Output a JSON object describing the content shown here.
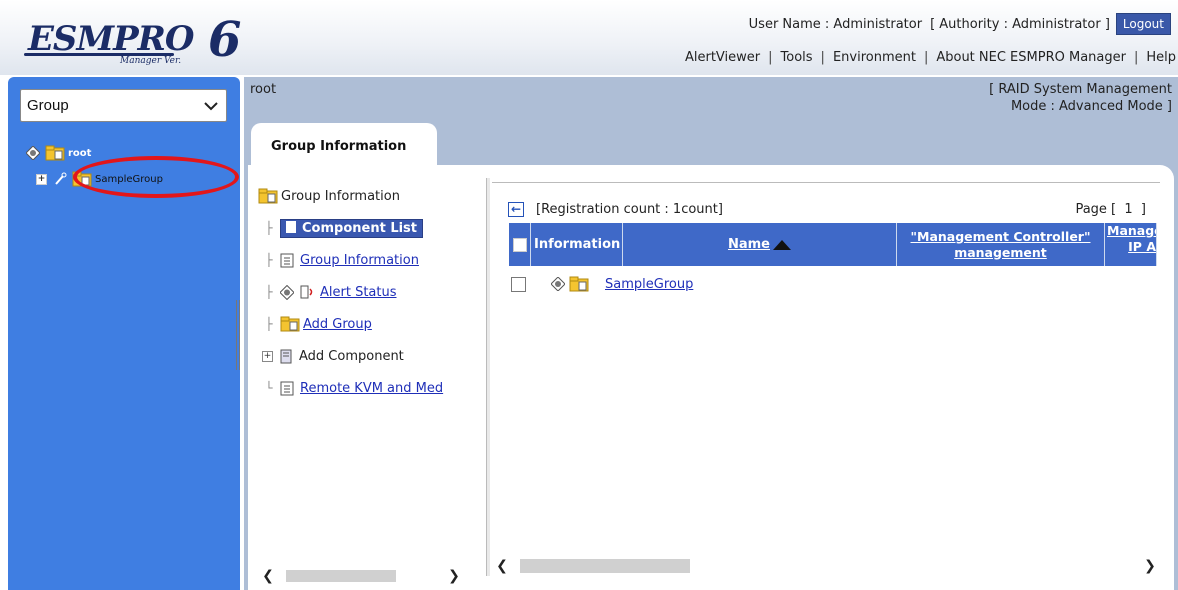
{
  "header": {
    "logo_text": "ESMPRO",
    "logo_number": "6",
    "logo_sub": "Manager Ver.",
    "user_label": "User Name : Administrator",
    "authority_label": "[ Authority : Administrator ]",
    "logout_label": "Logout",
    "nav": [
      "AlertViewer",
      "Tools",
      "Environment",
      "About NEC ESMPRO Manager",
      "Help"
    ]
  },
  "sidebar": {
    "select_value": "Group",
    "tree": {
      "root_label": "root",
      "child_label": "SampleGroup"
    }
  },
  "main": {
    "breadcrumb": "root",
    "mode_line1": "[ RAID System Management",
    "mode_line2": "Mode : Advanced Mode ]",
    "tab_label": "Group Information"
  },
  "nav_tree": {
    "root_label": "Group Information",
    "items": [
      {
        "label": "Component List",
        "selected": true
      },
      {
        "label": "Group Information"
      },
      {
        "label": "Alert Status"
      },
      {
        "label": "Add Group"
      },
      {
        "label": "Add Component"
      },
      {
        "label": "Remote KVM and Med"
      }
    ]
  },
  "content": {
    "registration_count": "[Registration count : 1count]",
    "page_indicator": "Page [  1  ]",
    "columns": {
      "information": "Information",
      "name": "Name",
      "mc_line1": "\"Management Controller\"",
      "mc_line2": "management",
      "extra_line1": "Manage",
      "extra_line2": "IP A"
    },
    "rows": [
      {
        "name": "SampleGroup"
      }
    ]
  },
  "colors": {
    "sidebar_blue": "#3f7ee2",
    "header_blue": "#3f69c8",
    "highlight_red": "#e2161a",
    "link_blue": "#1f2fb8"
  }
}
